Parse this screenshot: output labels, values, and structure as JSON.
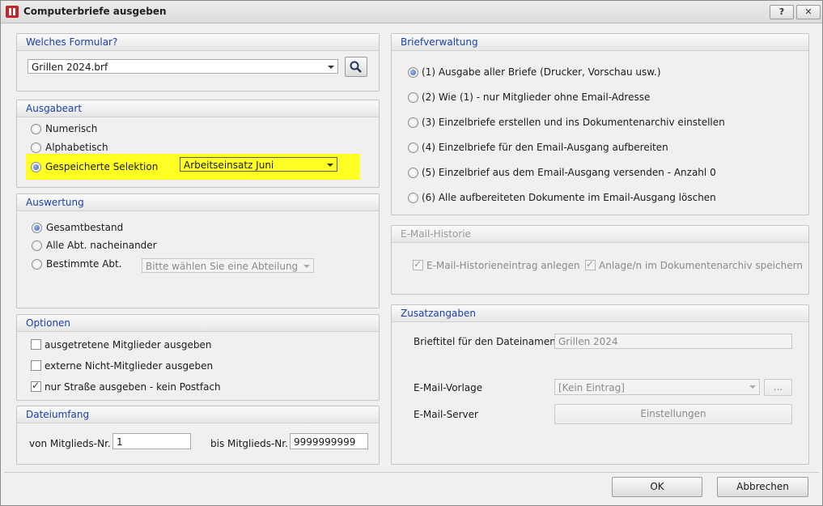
{
  "window": {
    "title": "Computerbriefe ausgeben",
    "help_label": "?",
    "close_label": "✕"
  },
  "formular": {
    "header": "Welches Formular?",
    "value": "Grillen 2024.brf"
  },
  "ausgabeart": {
    "header": "Ausgabeart",
    "options": [
      "Numerisch",
      "Alphabetisch",
      "Gespeicherte Selektion"
    ],
    "selected": 2,
    "selektion_value": "Arbeitseinsatz Juni",
    "highlight_color": "#ffff24"
  },
  "auswertung": {
    "header": "Auswertung",
    "options": [
      "Gesamtbestand",
      "Alle Abt. nacheinander",
      "Bestimmte Abt."
    ],
    "selected": 0,
    "abteilung_placeholder": "Bitte wählen Sie eine Abteilung"
  },
  "optionen": {
    "header": "Optionen",
    "items": [
      {
        "label": "ausgetretene Mitglieder ausgeben",
        "checked": false
      },
      {
        "label": "externe Nicht-Mitglieder ausgeben",
        "checked": false
      },
      {
        "label": "nur Straße ausgeben - kein Postfach",
        "checked": true
      }
    ]
  },
  "dateiumfang": {
    "header": "Dateiumfang",
    "von_label": "von Mitglieds-Nr.",
    "von_value": "1",
    "bis_label": "bis Mitglieds-Nr.",
    "bis_value": "9999999999"
  },
  "briefverwaltung": {
    "header": "Briefverwaltung",
    "options": [
      "(1) Ausgabe aller Briefe (Drucker, Vorschau usw.)",
      "(2) Wie (1) - nur Mitglieder ohne Email-Adresse",
      "(3) Einzelbriefe erstellen und ins Dokumentenarchiv einstellen",
      "(4) Einzelbriefe für den Email-Ausgang aufbereiten",
      "(5) Einzelbrief aus dem Email-Ausgang versenden - Anzahl 0",
      "(6) Alle aufbereiteten Dokumente im Email-Ausgang löschen"
    ],
    "selected": 0
  },
  "email_historie": {
    "header": "E-Mail-Historie",
    "historie_label": "E-Mail-Historieneintrag anlegen",
    "anlage_label": "Anlage/n im Dokumentenarchiv speichern"
  },
  "zusatzangaben": {
    "header": "Zusatzangaben",
    "brieftitel_label": "Brieftitel für den Dateinamen",
    "brieftitel_value": "Grillen 2024",
    "vorlage_label": "E-Mail-Vorlage",
    "vorlage_value": "[Kein Eintrag]",
    "vorlage_more": "...",
    "server_label": "E-Mail-Server",
    "einstellungen_label": "Einstellungen"
  },
  "footer": {
    "ok_label": "OK",
    "abbrechen_label": "Abbrechen"
  }
}
